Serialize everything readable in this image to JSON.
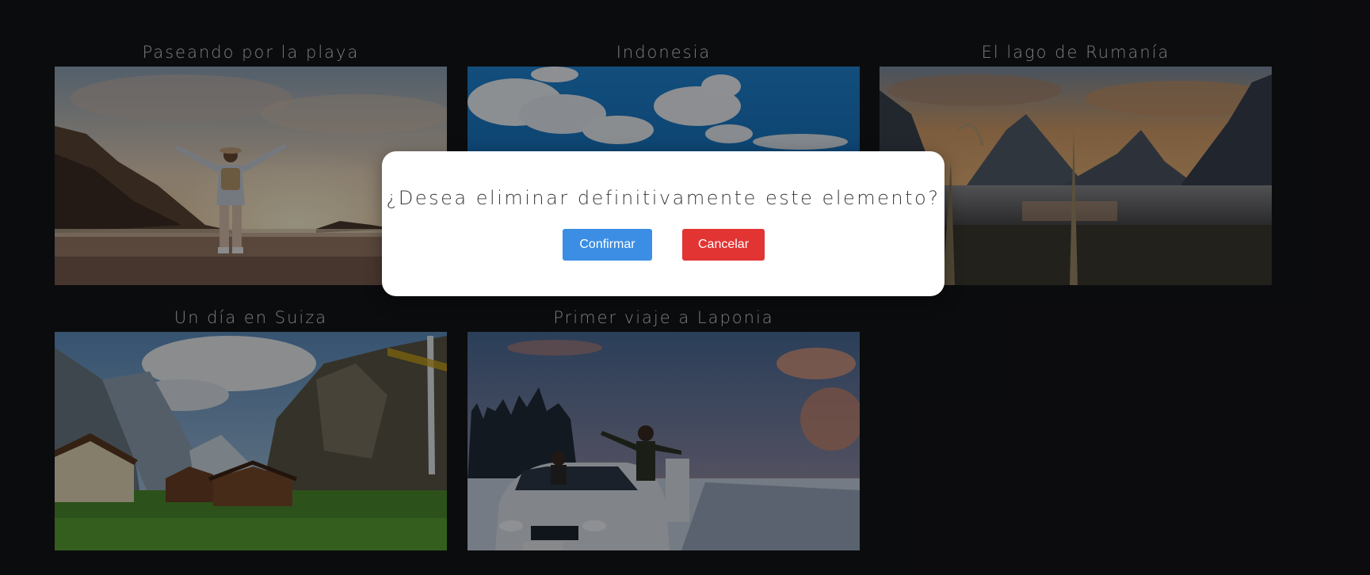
{
  "gallery": {
    "items": [
      {
        "title": "Paseando por la playa",
        "image": "beach-sunset-photo"
      },
      {
        "title": "Indonesia",
        "image": "indonesia-sky-photo"
      },
      {
        "title": "El lago de Rumanía",
        "image": "mountain-lake-photo"
      },
      {
        "title": "Un día en Suiza",
        "image": "swiss-valley-photo"
      },
      {
        "title": "Primer viaje a Laponia",
        "image": "lapland-snow-photo"
      }
    ]
  },
  "modal": {
    "message": "¿Desea eliminar definitivamente este elemento?",
    "confirm_label": "Confirmar",
    "cancel_label": "Cancelar"
  },
  "colors": {
    "background": "#141519",
    "confirm": "#3b8ee4",
    "cancel": "#e13433"
  }
}
